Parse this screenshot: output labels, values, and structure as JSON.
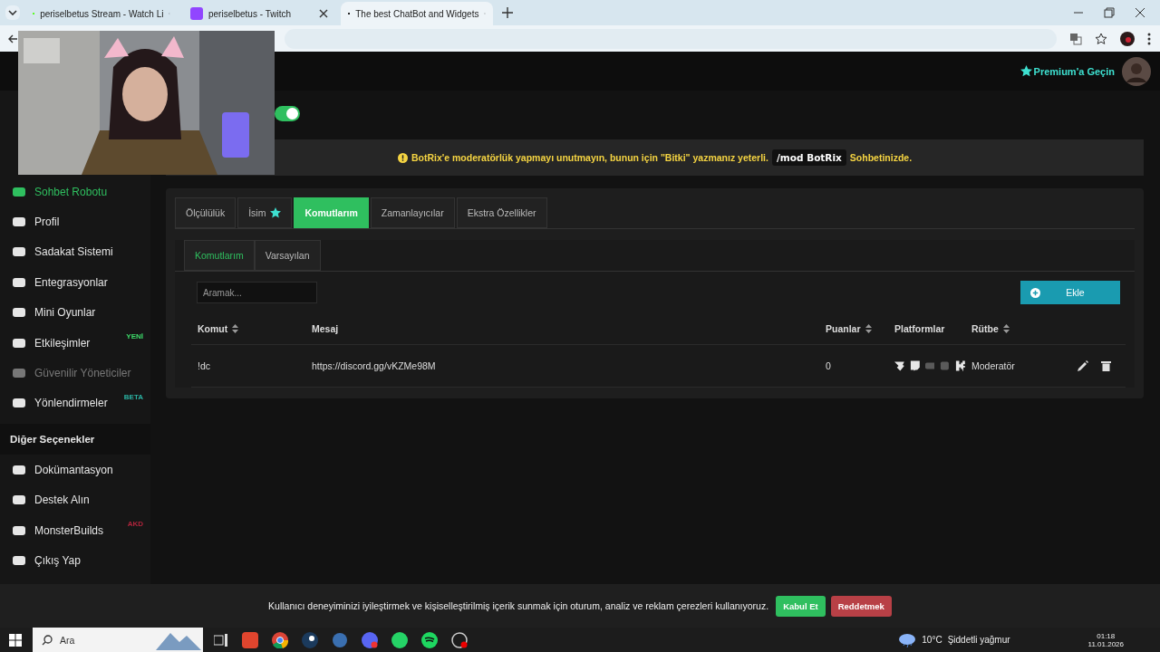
{
  "browser": {
    "tabs": [
      {
        "title": "periselbetus Stream - Watch Li",
        "kind": "kick",
        "selected": false
      },
      {
        "title": "periselbetus - Twitch",
        "kind": "twitch",
        "selected": false
      },
      {
        "title": "The best ChatBot and Widgets",
        "kind": "botrix",
        "selected": true
      }
    ]
  },
  "header": {
    "premium_link": "Premium'a Geçin"
  },
  "toggle": {
    "on": true
  },
  "notice": {
    "text": "BotRix'e moderatörlük yapmayı unutmayın, bunun için \"Bitki\" yazmanız yeterli.",
    "command": "/mod BotRix",
    "suffix": "Sohbetinizde."
  },
  "sidebar": {
    "items": [
      {
        "label": "Sohbet Robotu",
        "selected": true,
        "disabled": false
      },
      {
        "label": "Profil",
        "selected": false,
        "disabled": false
      },
      {
        "label": "Sadakat Sistemi",
        "selected": false,
        "disabled": false
      },
      {
        "label": "Entegrasyonlar",
        "selected": false,
        "disabled": false
      },
      {
        "label": "Mini Oyunlar",
        "selected": false,
        "disabled": false
      },
      {
        "label": "Etkileşimler",
        "selected": false,
        "disabled": false,
        "badge": "YENİ",
        "color": "#3ddc6a"
      },
      {
        "label": "Güvenilir Yöneticiler",
        "selected": false,
        "disabled": true
      },
      {
        "label": "Yönlendirmeler",
        "selected": false,
        "disabled": false,
        "badge": "BETA",
        "color": "#2bb3a3"
      }
    ],
    "section": "Diğer Seçenekler",
    "other_items": [
      {
        "label": "Dokümantasyon"
      },
      {
        "label": "Destek Alın"
      },
      {
        "label": "MonsterBuilds",
        "badge": "AKD",
        "color": "#b0243c"
      },
      {
        "label": "Çıkış Yap"
      }
    ]
  },
  "tabs": [
    {
      "label": "Ölçülülük",
      "selected": false,
      "starred": false
    },
    {
      "label": "İsim",
      "selected": false,
      "starred": true
    },
    {
      "label": "Komutlarım",
      "selected": true,
      "starred": false
    },
    {
      "label": "Zamanlayıcılar",
      "selected": false,
      "starred": false
    },
    {
      "label": "Ekstra Özellikler",
      "selected": false,
      "starred": false
    }
  ],
  "subtabs": [
    {
      "label": "Komutlarım",
      "selected": true
    },
    {
      "label": "Varsayılan",
      "selected": false
    }
  ],
  "search": {
    "placeholder": "Aramak..."
  },
  "add_button": "Ekle",
  "table": {
    "columns": [
      {
        "label": "Komut",
        "sortable": true
      },
      {
        "label": "Mesaj",
        "sortable": false
      },
      {
        "label": "Puanlar",
        "sortable": true
      },
      {
        "label": "Platformlar",
        "sortable": false
      },
      {
        "label": "Rütbe",
        "sortable": true
      }
    ],
    "rows": [
      {
        "command": "!dc",
        "message": "https://discord.gg/vKZMe98M",
        "points": "0",
        "rank": "Moderatör",
        "platforms": [
          {
            "kind": "shield",
            "on": true
          },
          {
            "kind": "twitch",
            "on": true
          },
          {
            "kind": "youtube",
            "on": false
          },
          {
            "kind": "discord",
            "on": false
          },
          {
            "kind": "kick",
            "on": true
          }
        ]
      }
    ]
  },
  "cookie": {
    "text": "Kullanıcı deneyiminizi iyileştirmek ve kişiselleştirilmiş içerik sunmak için oturum, analiz ve reklam çerezleri kullanıyoruz.",
    "accept": "Kabul Et",
    "reject": "Reddetmek"
  },
  "taskbar": {
    "search_placeholder": "Ara",
    "temperature": "10°C",
    "weather": "Şiddetli yağmur",
    "time": "01:18",
    "date": "11.01.2026"
  }
}
